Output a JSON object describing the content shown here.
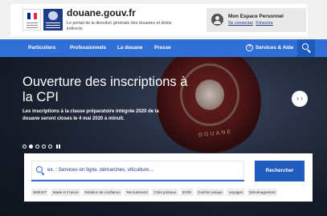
{
  "header": {
    "site_title": "douane.gouv.fr",
    "site_subtitle": "Le portail de la direction générale des douanes et droits indirects",
    "account": {
      "title": "Mon Espace Personnel",
      "login_link": "Se connecter",
      "register_link": "S'inscrire"
    }
  },
  "nav": {
    "items": [
      "Particuliers",
      "Professionnels",
      "La douane",
      "Presse"
    ],
    "services_label": "Services & Aide",
    "help_symbol": "?"
  },
  "hero": {
    "title": "Ouverture des inscriptions à la CPI",
    "text": "Les inscriptions à la classe préparatoire intégrée 2020 de la douane seront closes le 4 mai 2020 à minuit.",
    "badge_text": "DOUANE",
    "arrows_symbol": "‹ ›",
    "carousel": {
      "slide_count": 5,
      "active_index": 1
    }
  },
  "search": {
    "placeholder": "ex. : Services en ligne, démarches, viticulture...",
    "submit_label": "Rechercher",
    "tags": [
      "BREXIT",
      "Made in France",
      "Relation de confiance",
      "Recrutement",
      "Colis postaux",
      "EORI",
      "Guichet unique",
      "Voyages",
      "Déménagement"
    ]
  },
  "colors": {
    "nav_blue": "#2f6fd6",
    "button_blue": "#1f5bbd",
    "dgddi_blue": "#1d3b87",
    "flag_blue": "#002395",
    "flag_white": "#ffffff",
    "flag_red": "#ed2939"
  }
}
